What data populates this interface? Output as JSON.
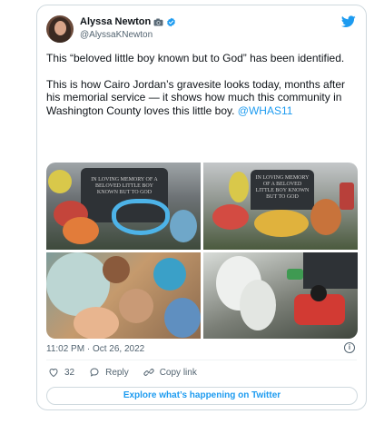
{
  "tweet": {
    "author_name": "Alyssa Newton",
    "author_handle": "@AlyssaKNewton",
    "paragraph1": "This “beloved little boy known but to God” has been identified.",
    "paragraph2_text": "This is how Cairo Jordan’s gravesite looks today, months after his memorial service — it shows how much this community in Washington County loves this little boy. ",
    "paragraph2_mention": "@WHAS11",
    "timestamp": "11:02 PM · Oct 26, 2022",
    "likes_count": "32",
    "reply_label": "Reply",
    "copy_link_label": "Copy link",
    "explore_label": "Explore what’s happening on Twitter",
    "info_symbol": "i"
  },
  "media": {
    "stone_text_1": "IN LOVING MEMORY OF A BELOVED LITTLE BOY KNOWN BUT TO GOD",
    "stone_text_2": "IN LOVING MEMORY OF A BELOVED LITTLE BOY KNOWN BUT TO GOD"
  },
  "icons": {
    "camera": "camera-emoji-icon",
    "verified": "verified-badge-icon",
    "twitter": "twitter-bird-icon",
    "like": "heart-icon",
    "reply": "reply-bubble-icon",
    "copy_link": "link-icon",
    "info": "info-icon"
  },
  "colors": {
    "accent": "#1d9bf0",
    "text": "#0f1419",
    "secondary": "#536471",
    "border": "#cfd9de"
  }
}
